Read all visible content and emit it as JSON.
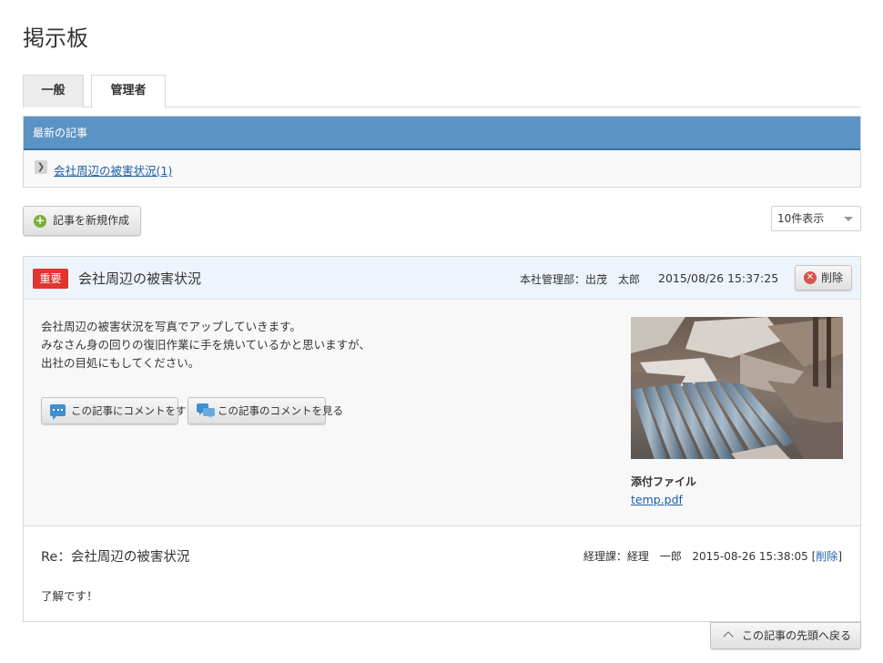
{
  "page": {
    "title": "掲示板"
  },
  "tabs": [
    {
      "label": "一般"
    },
    {
      "label": "管理者"
    }
  ],
  "latest": {
    "header": "最新の記事",
    "items": [
      {
        "label": "会社周辺の被害状況(1)"
      }
    ]
  },
  "toolbar": {
    "new_article_label": "記事を新規作成",
    "count_select_value": "10件表示"
  },
  "article": {
    "badge": "重要",
    "title": "会社周辺の被害状況",
    "author": "本社管理部：出茂　太郎",
    "date": "2015/08/26 15:37:25",
    "delete_label": "削除",
    "body_lines": [
      "会社周辺の被害状況を写真でアップしていきます。",
      "みなさん身の回りの復旧作業に手を焼いているかと思いますが、",
      "出社の目処にもしてください。"
    ],
    "comment_button_label": "この記事にコメントをする",
    "view_comments_label": "この記事のコメントを見る",
    "attachment_label": "添付ファイル",
    "attachment_file": "temp.pdf"
  },
  "reply": {
    "title": "Re：会社周辺の被害状況",
    "author": "経理課：経理　一郎",
    "date": "2015-08-26 15:38:05",
    "delete_link": "削除",
    "text": "了解です！"
  },
  "footer": {
    "back_to_top_label": "この記事の先頭へ戻る"
  },
  "colors": {
    "header_blue": "#5a93c4",
    "badge_red": "#e03530",
    "link_blue": "#1a5ea8",
    "plus_green": "#7ab03a"
  }
}
